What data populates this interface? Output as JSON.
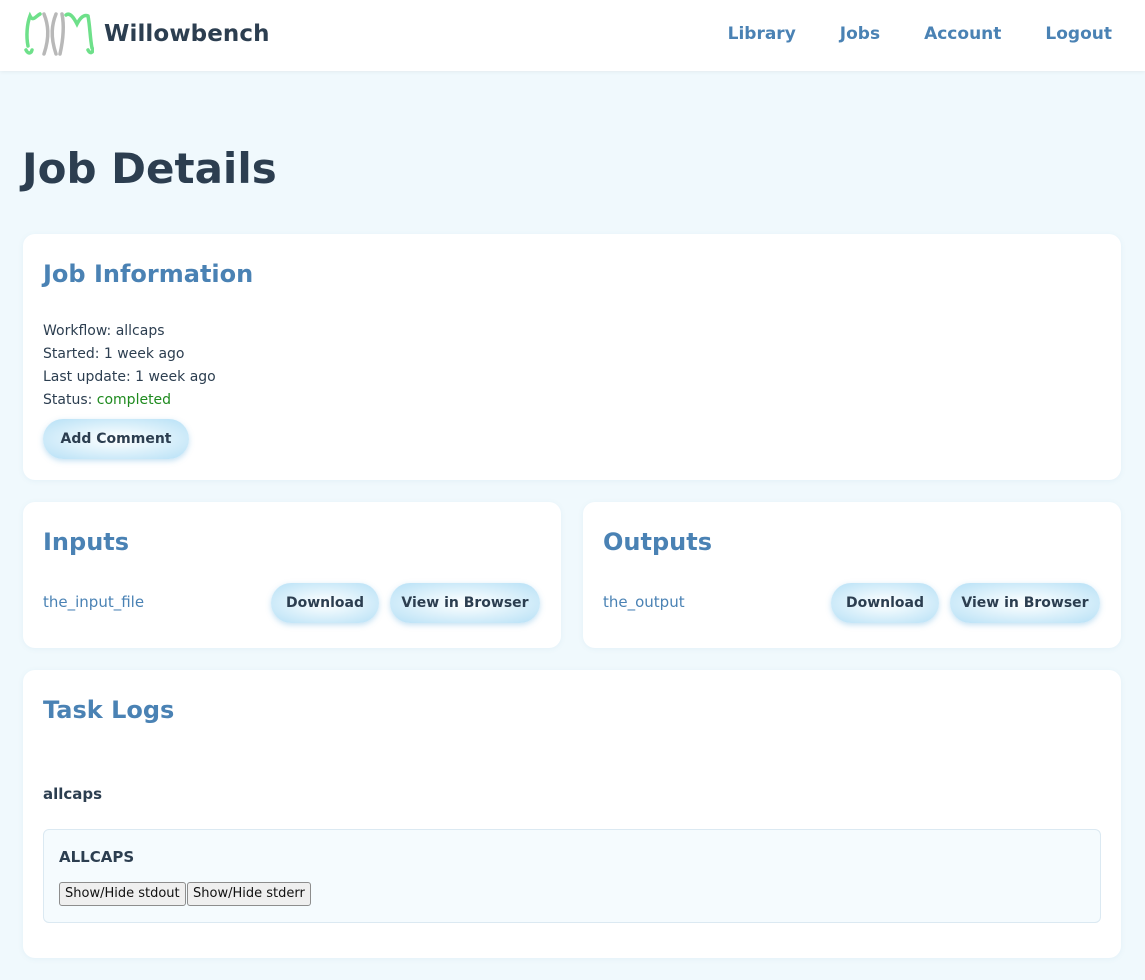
{
  "header": {
    "brand": "Willowbench",
    "nav": [
      "Library",
      "Jobs",
      "Account",
      "Logout"
    ]
  },
  "page": {
    "title": "Job Details"
  },
  "job_info": {
    "heading": "Job Information",
    "workflow_label": "Workflow:",
    "workflow": "allcaps",
    "started_label": "Started:",
    "started": "1 week ago",
    "updated_label": "Last update:",
    "updated": "1 week ago",
    "status_label": "Status:",
    "status": "completed",
    "add_comment": "Add Comment"
  },
  "inputs": {
    "heading": "Inputs",
    "file": "the_input_file",
    "download": "Download",
    "view": "View in Browser"
  },
  "outputs": {
    "heading": "Outputs",
    "file": "the_output",
    "download": "Download",
    "view": "View in Browser"
  },
  "task_logs": {
    "heading": "Task Logs",
    "task": "allcaps",
    "log_title": "ALLCAPS",
    "stdout_btn": "Show/Hide stdout",
    "stderr_btn": "Show/Hide stderr"
  },
  "colors": {
    "accent": "#4a82b4",
    "status_ok": "#1e8a1e",
    "background": "#f0f9fd",
    "logo_green": "#6ee08a",
    "logo_gray": "#b8b8b8"
  }
}
